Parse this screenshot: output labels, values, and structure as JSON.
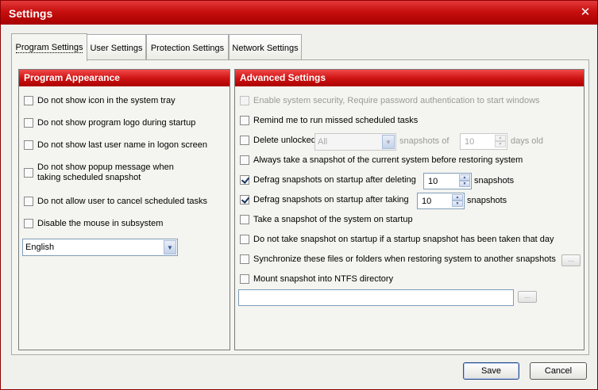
{
  "window": {
    "title": "Settings",
    "close_symbol": "✕"
  },
  "tabs": [
    {
      "label": "Program Settings",
      "active": true
    },
    {
      "label": "User Settings"
    },
    {
      "label": "Protection Settings"
    },
    {
      "label": "Network Settings"
    }
  ],
  "appearance": {
    "header": "Program Appearance",
    "options": [
      {
        "label": "Do not show icon in the system tray",
        "checked": false
      },
      {
        "label": "Do not show program logo during startup",
        "checked": false
      },
      {
        "label": "Do not show last user name in logon screen",
        "checked": false
      },
      {
        "label": "Do not show popup message when\ntaking scheduled snapshot",
        "checked": false
      },
      {
        "label": "Do not allow user to cancel scheduled tasks",
        "checked": false
      },
      {
        "label": "Disable the mouse in subsystem",
        "checked": false
      }
    ],
    "language": "English"
  },
  "advanced": {
    "header": "Advanced Settings",
    "enable_security": "Enable system security, Require password authentication to start windows",
    "remind_missed": "Remind me to run missed scheduled tasks",
    "delete_unlocked": {
      "label": "Delete unlocked",
      "select_value": "All",
      "mid_label": "snapshots of",
      "days_value": "10",
      "suffix": "days old"
    },
    "always_snapshot": "Always take a snapshot of the current system before restoring system",
    "defrag_deleting": {
      "label": "Defrag snapshots on startup after deleting",
      "value": "10",
      "suffix": "snapshots",
      "checked": true
    },
    "defrag_taking": {
      "label": "Defrag snapshots on startup after taking",
      "value": "10",
      "suffix": "snapshots",
      "checked": true
    },
    "snapshot_startup": "Take a snapshot of the system on startup",
    "no_snapshot_today": "Do not take snapshot on startup if a startup snapshot has been taken that day",
    "synchronize": "Synchronize these files or folders when restoring system to another snapshots",
    "mount_ntfs": "Mount snapshot into NTFS directory",
    "browse_label": "...",
    "mount_path": ""
  },
  "buttons": {
    "save": "Save",
    "cancel": "Cancel"
  },
  "icons": {
    "dropdown": "▼",
    "spin_up": "▲",
    "spin_down": "▼"
  }
}
